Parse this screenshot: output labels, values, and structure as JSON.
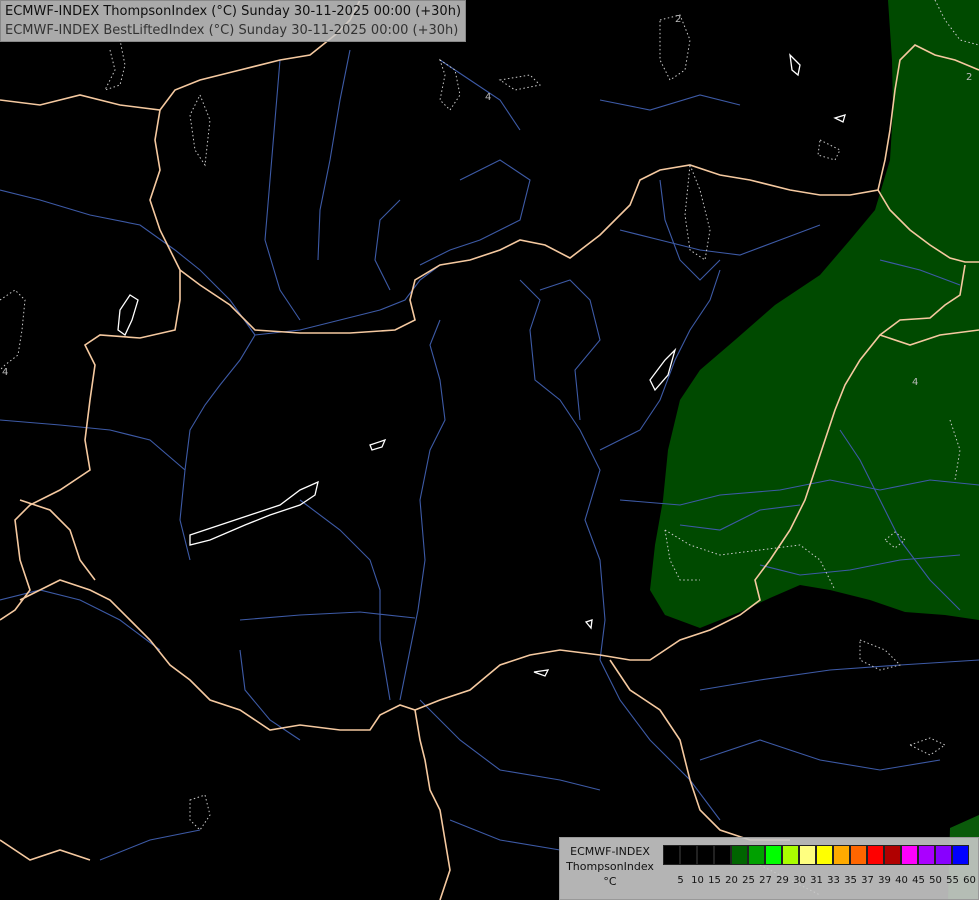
{
  "header": {
    "line1": "ECMWF-INDEX ThompsonIndex (°C) Sunday 30-11-2025 00:00 (+30h)",
    "line2": "ECMWF-INDEX BestLiftedIndex (°C) Sunday 30-11-2025 00:00 (+30h)"
  },
  "legend": {
    "line1": "ECMWF-INDEX",
    "line2": "ThompsonIndex",
    "unit": "°C",
    "colors": [
      "#000000",
      "#000000",
      "#000000",
      "#000000",
      "#006400",
      "#00a000",
      "#00ff00",
      "#aaff00",
      "#ffff80",
      "#ffff00",
      "#ffaa00",
      "#ff6600",
      "#ff0000",
      "#b00000",
      "#ff00ff",
      "#aa00ff",
      "#8800ff",
      "#0000ff"
    ],
    "ticks": [
      "5",
      "10",
      "15",
      "20",
      "25",
      "27",
      "29",
      "30",
      "31",
      "33",
      "35",
      "37",
      "39",
      "40",
      "45",
      "50",
      "55",
      "60"
    ]
  },
  "map": {
    "contour_labels": [
      "4",
      "2",
      "4",
      "4",
      "2"
    ],
    "colors": {
      "background": "#000000",
      "border": "#f5c9a0",
      "river": "#3d5aa6",
      "fill": "#004d00",
      "lake": "#ffffff",
      "contour": "#cccccc"
    }
  }
}
